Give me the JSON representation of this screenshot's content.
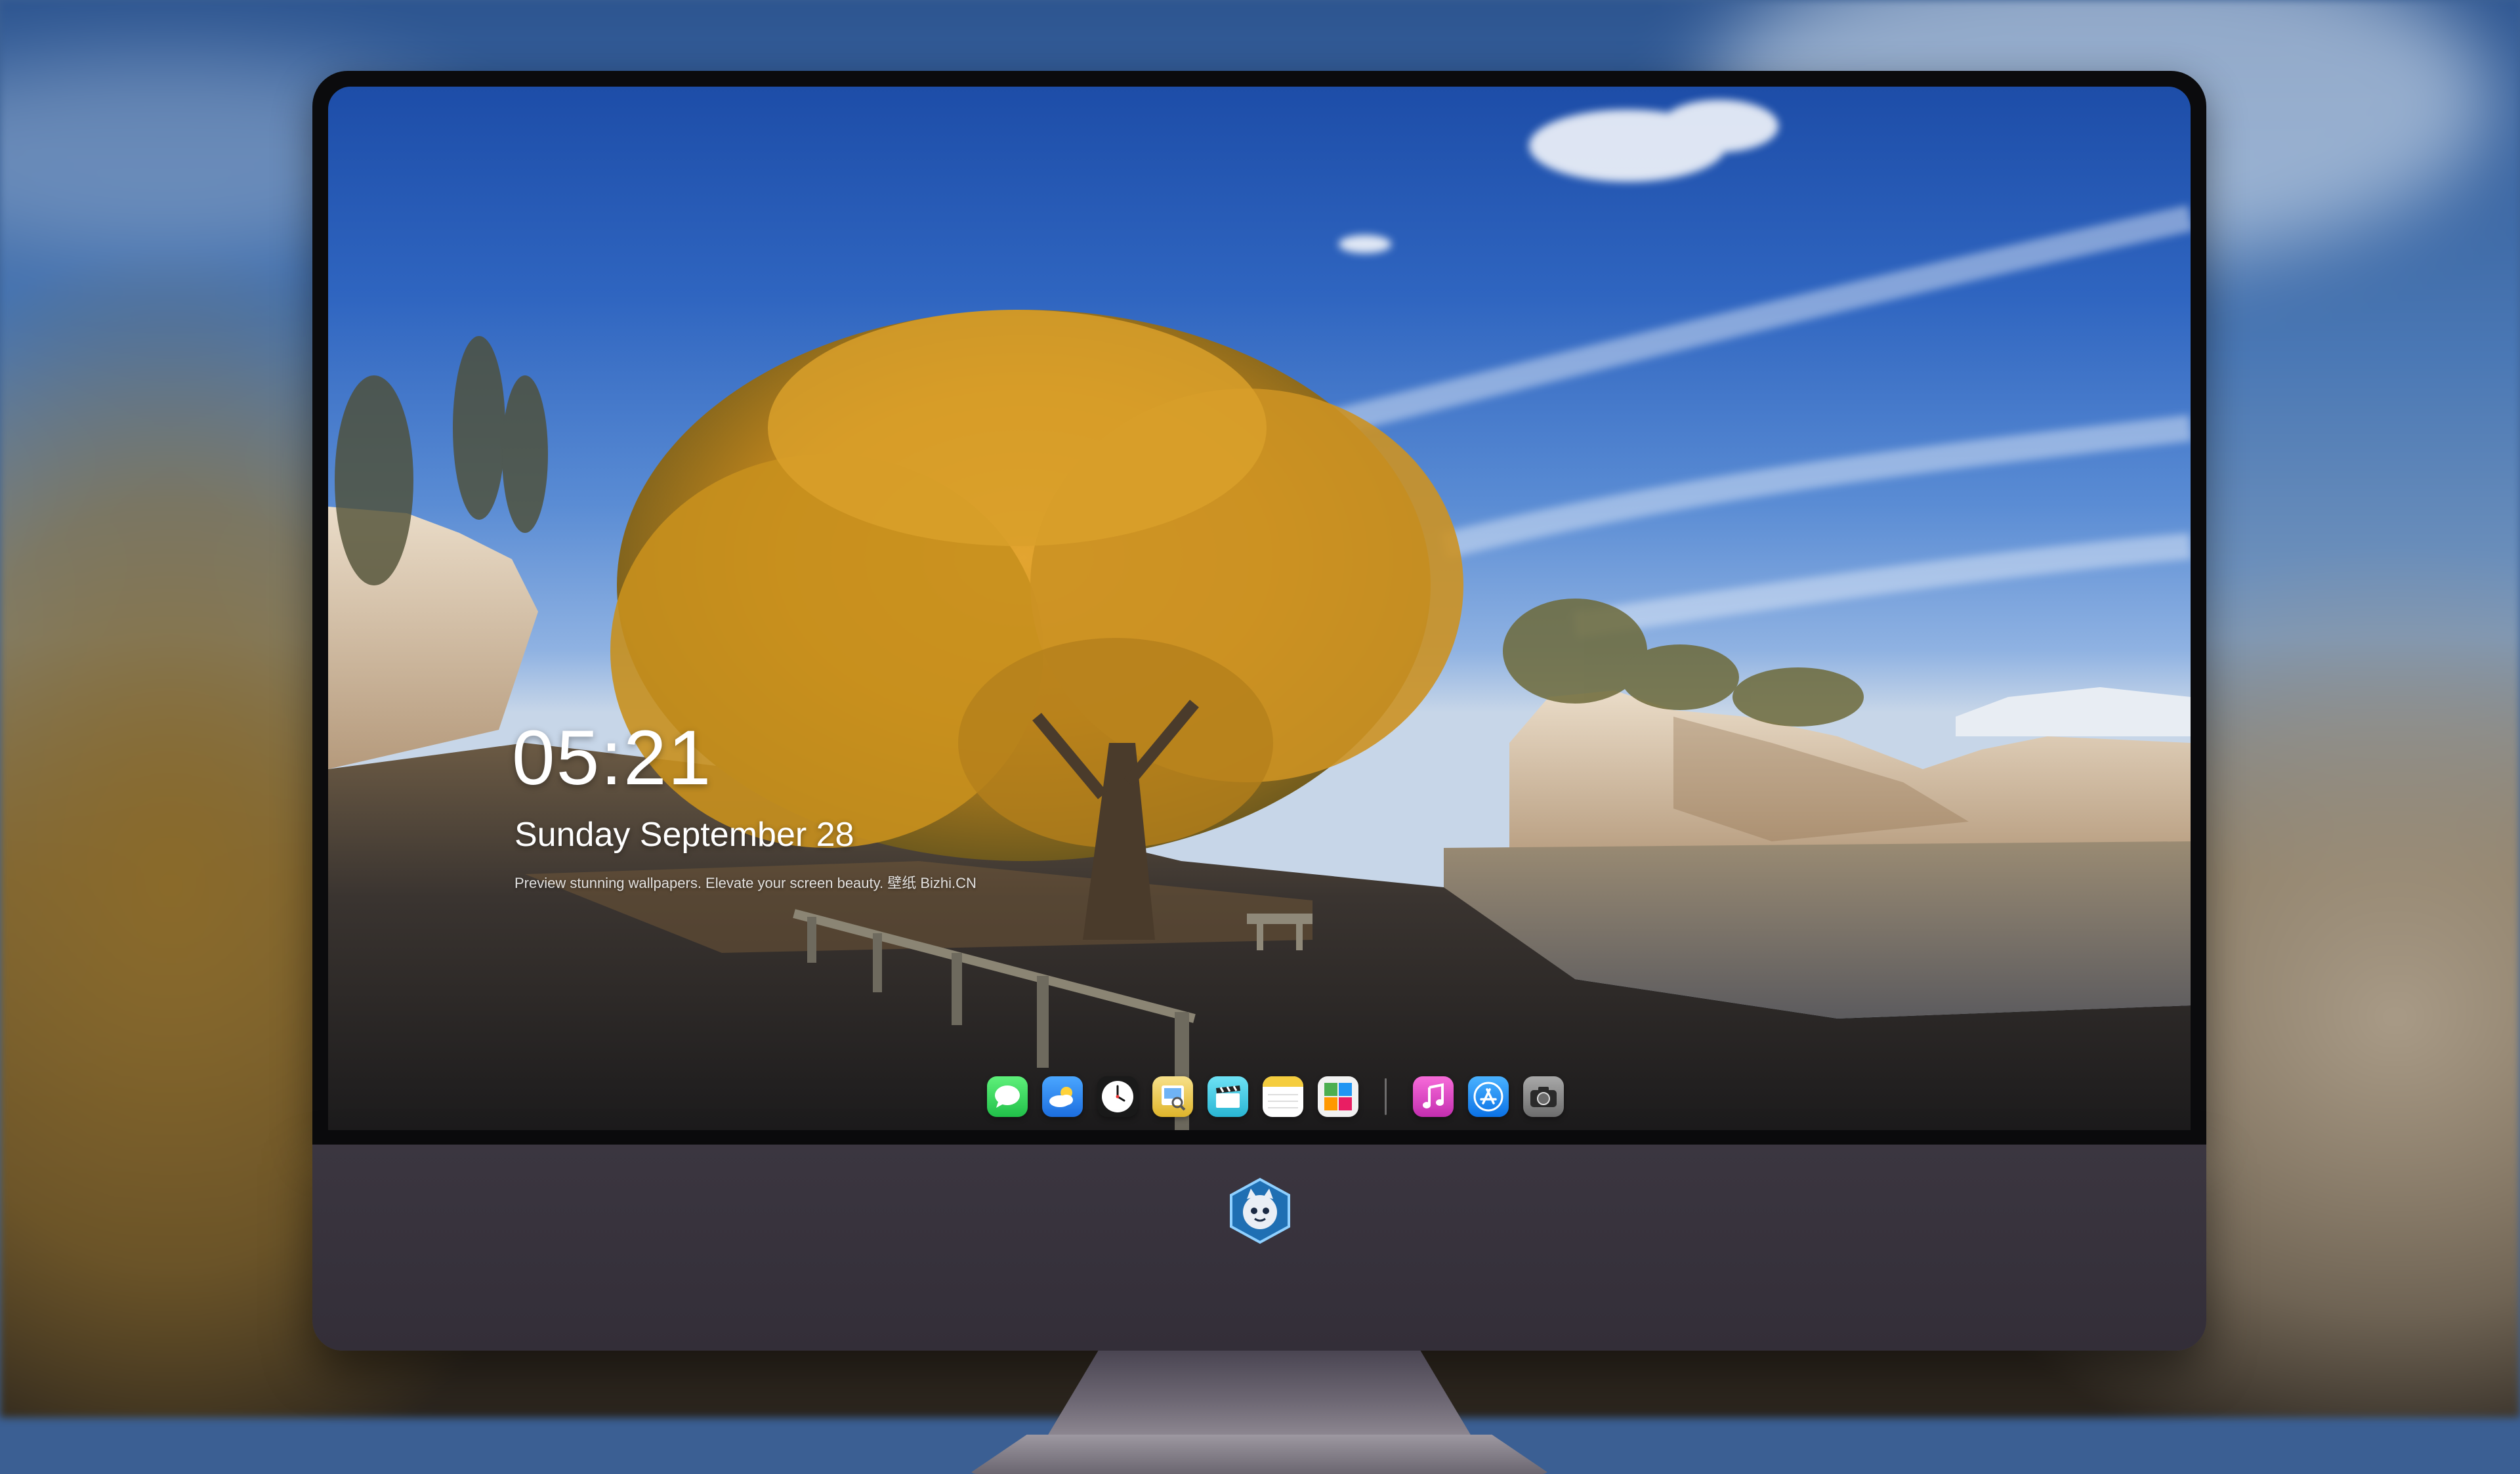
{
  "lock_screen": {
    "time": "05:21",
    "date": "Sunday September  28",
    "caption": "Preview stunning wallpapers. Elevate your screen beauty. 壁纸 Bizhi.CN"
  },
  "dock": {
    "apps": [
      {
        "name": "Messages",
        "icon": "messages-icon",
        "color": "#2fd158"
      },
      {
        "name": "Weather",
        "icon": "weather-icon",
        "color": "#2f8cf0"
      },
      {
        "name": "Clock",
        "icon": "clock-icon",
        "color": "#111111"
      },
      {
        "name": "Preview",
        "icon": "preview-icon",
        "color": "#e9c23a"
      },
      {
        "name": "Clips",
        "icon": "clapperboard-icon",
        "color": "#4fd0e8"
      },
      {
        "name": "Notes",
        "icon": "notes-icon",
        "color": "#f7d24a"
      },
      {
        "name": "Photo Booth",
        "icon": "photo-grid-icon",
        "color": "#f0f0f0"
      },
      {
        "name": "Music",
        "icon": "music-icon",
        "color": "#e845c8"
      },
      {
        "name": "App Store",
        "icon": "app-store-icon",
        "color": "#1e8ef5"
      },
      {
        "name": "Camera",
        "icon": "camera-icon",
        "color": "#8c8c8c"
      }
    ]
  },
  "chin": {
    "logo": "mascot-logo-icon"
  }
}
